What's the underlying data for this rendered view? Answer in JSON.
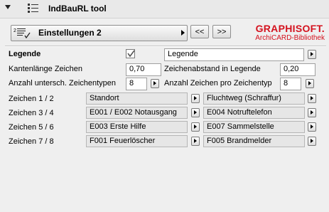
{
  "header": {
    "title": "IndBauRL tool",
    "icons": [
      "collapse-triangle",
      "grid-list-icon"
    ]
  },
  "toolbar": {
    "preset_label": "Einstellungen 2",
    "prev_label": "<<",
    "next_label": ">>"
  },
  "brand": {
    "name": "GRAPHISOFT.",
    "subtitle": "ArchiCARD-Bibliothek",
    "color": "#d4121e"
  },
  "legende": {
    "label": "Legende",
    "checked": true,
    "value": "Legende"
  },
  "settings": {
    "kantenlaenge_label": "Kantenlänge Zeichen",
    "kantenlaenge_value": "0,70",
    "abstand_label": "Zeichenabstand in Legende",
    "abstand_value": "0,20",
    "anzahl_typen_label": "Anzahl untersch. Zeichentypen",
    "anzahl_typen_value": "8",
    "anzahl_pro_label": "Anzahl Zeichen pro Zeichentyp",
    "anzahl_pro_value": "8"
  },
  "zeichen": [
    {
      "label": "Zeichen 1 / 2",
      "left": "Standort",
      "right": "Fluchtweg (Schraffur)"
    },
    {
      "label": "Zeichen 3 / 4",
      "left": "E001 / E002 Notausgang",
      "right": "E004  Notruftelefon"
    },
    {
      "label": "Zeichen 5 / 6",
      "left": "E003  Erste Hilfe",
      "right": "E007  Sammelstelle"
    },
    {
      "label": "Zeichen 7 / 8",
      "left": "F001 Feuerlöscher",
      "right": "F005 Brandmelder"
    }
  ]
}
